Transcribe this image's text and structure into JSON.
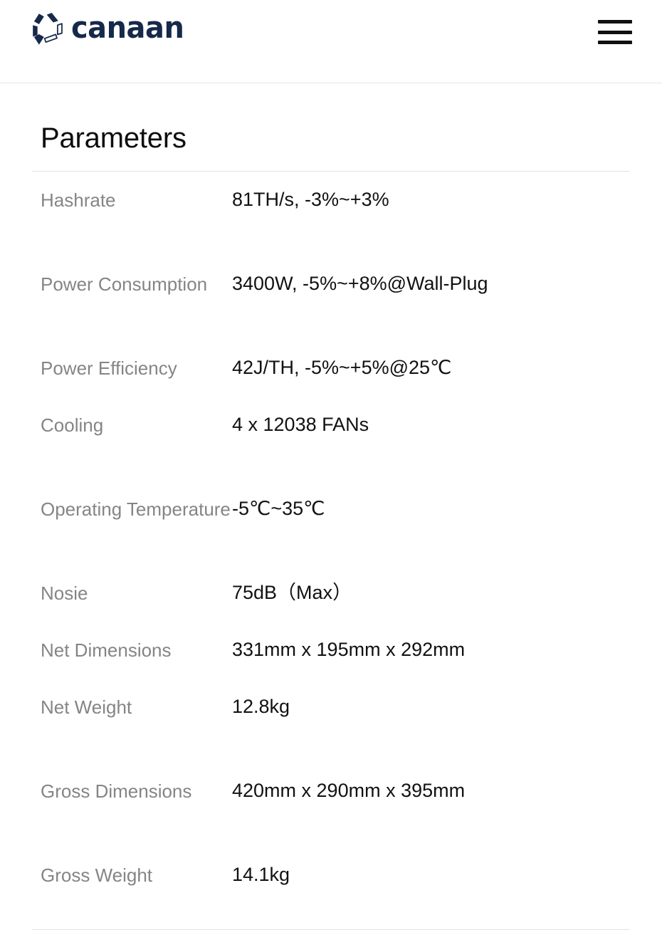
{
  "header": {
    "brand_name": "canaan",
    "brand_color": "#16294a",
    "logo_icon": "canaan-hexagon-logo",
    "menu_icon": "hamburger-menu-icon",
    "menu_label": "Menu"
  },
  "main": {
    "section_title": "Parameters",
    "parameters": [
      {
        "label": "Hashrate",
        "value": "81TH/s, -3%~+3%",
        "wrap": false
      },
      {
        "label": "Power Consumption",
        "value": "3400W, -5%~+8%@Wall-Plug",
        "wrap": true
      },
      {
        "label": "Power Efficiency",
        "value": "42J/TH, -5%~+5%@25℃",
        "wrap": false
      },
      {
        "label": "Cooling",
        "value": "4 x 12038 FANs",
        "wrap": false
      },
      {
        "label": "Operating Temperature",
        "value": "-5℃~35℃",
        "wrap": true
      },
      {
        "label": "Nosie",
        "value": "75dB（Max）",
        "wrap": false
      },
      {
        "label": "Net Dimensions",
        "value": "331mm x 195mm x 292mm",
        "wrap": false
      },
      {
        "label": "Net Weight",
        "value": "12.8kg",
        "wrap": false
      },
      {
        "label": "Gross Dimensions",
        "value": "420mm x 290mm x 395mm",
        "wrap": true
      },
      {
        "label": "Gross Weight",
        "value": "14.1kg",
        "wrap": false
      }
    ]
  },
  "theme": {
    "label_color": "#858585",
    "value_color": "#111111",
    "rule_color": "#e3e3e3"
  }
}
